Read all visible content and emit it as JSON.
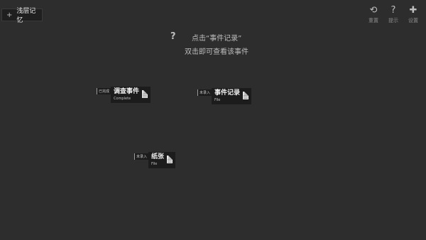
{
  "header": {
    "add_label": "+",
    "memory_label": "浅层记忆"
  },
  "actions": [
    {
      "icon": "reset-icon",
      "glyph": "⟲",
      "label": "重置"
    },
    {
      "icon": "hint-icon",
      "glyph": "?",
      "label": "提示"
    },
    {
      "icon": "settings-icon",
      "glyph": "✚",
      "label": "设置"
    }
  ],
  "hint": {
    "icon": "question-icon",
    "glyph": "?",
    "line1": "点击“事件记录”",
    "line2": "双击即可查看该事件"
  },
  "events": [
    {
      "tag": "已完成",
      "title": "调查事件",
      "sub": "Complete"
    },
    {
      "tag": "未录入",
      "title": "事件记录",
      "sub": "File"
    },
    {
      "tag": "未录入",
      "title": "纸张",
      "sub": "File"
    }
  ],
  "colors": {
    "background": "#2d2d2d",
    "card": "#1c1c1c",
    "text": "#bdbdbd"
  }
}
